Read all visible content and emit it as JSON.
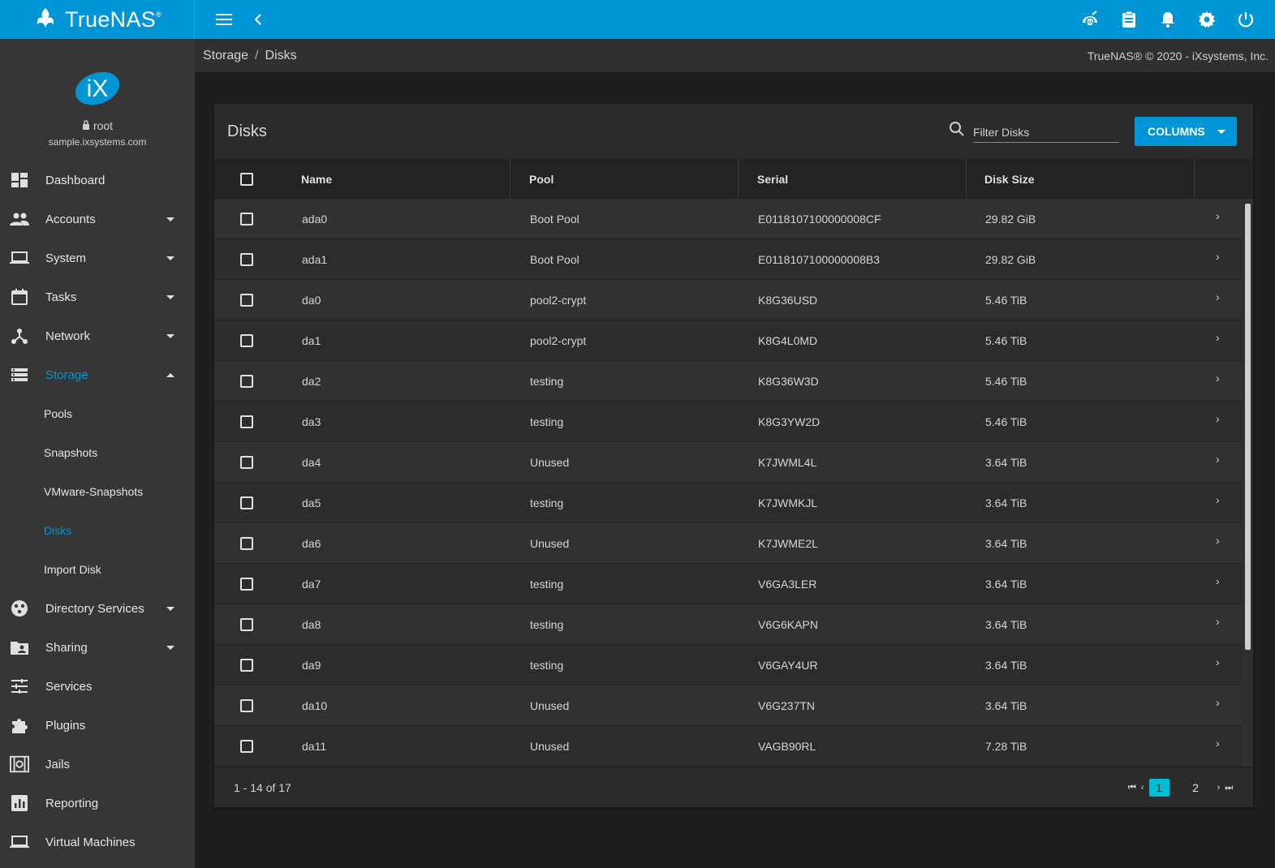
{
  "app": {
    "brand": "TrueNAS",
    "brand_reg": "®"
  },
  "colors": {
    "primary": "#0095d5",
    "accent": "#00bcd4",
    "sidebar_bg": "#363636",
    "content_bg": "#1e1e1e"
  },
  "topbar": {
    "icons": [
      "menu-icon",
      "back-icon",
      "ha-icon",
      "clipboard-icon",
      "bell-icon",
      "gear-icon",
      "power-icon"
    ]
  },
  "profile": {
    "logo_text": "iX",
    "user": "root",
    "host": "sample.ixsystems.com"
  },
  "sidebar": {
    "items": [
      {
        "label": "Dashboard",
        "icon": "dashboard-icon"
      },
      {
        "label": "Accounts",
        "icon": "accounts-icon"
      },
      {
        "label": "System",
        "icon": "laptop-icon"
      },
      {
        "label": "Tasks",
        "icon": "calendar-icon"
      },
      {
        "label": "Network",
        "icon": "network-icon"
      },
      {
        "label": "Storage",
        "icon": "storage-icon"
      },
      {
        "label": "Directory Services",
        "icon": "directory-icon"
      },
      {
        "label": "Sharing",
        "icon": "folder-shared-icon"
      },
      {
        "label": "Services",
        "icon": "tune-icon"
      },
      {
        "label": "Plugins",
        "icon": "puzzle-icon"
      },
      {
        "label": "Jails",
        "icon": "jail-icon"
      },
      {
        "label": "Reporting",
        "icon": "chart-icon"
      },
      {
        "label": "Virtual Machines",
        "icon": "computer-icon"
      }
    ],
    "storage_sub": [
      "Pools",
      "Snapshots",
      "VMware-Snapshots",
      "Disks",
      "Import Disk"
    ]
  },
  "breadcrumb": {
    "parent": "Storage",
    "sep": "/",
    "current": "Disks"
  },
  "copyright": "TrueNAS® © 2020 - iXsystems, Inc.",
  "card": {
    "title": "Disks",
    "filter_placeholder": "Filter Disks",
    "columns_button": "COLUMNS"
  },
  "table": {
    "headers": {
      "name": "Name",
      "pool": "Pool",
      "serial": "Serial",
      "size": "Disk Size"
    },
    "rows": [
      {
        "name": "ada0",
        "pool": "Boot Pool",
        "serial": "E0118107100000008CF",
        "size": "29.82 GiB"
      },
      {
        "name": "ada1",
        "pool": "Boot Pool",
        "serial": "E0118107100000008B3",
        "size": "29.82 GiB"
      },
      {
        "name": "da0",
        "pool": "pool2-crypt",
        "serial": "K8G36USD",
        "size": "5.46 TiB"
      },
      {
        "name": "da1",
        "pool": "pool2-crypt",
        "serial": "K8G4L0MD",
        "size": "5.46 TiB"
      },
      {
        "name": "da2",
        "pool": "testing",
        "serial": "K8G36W3D",
        "size": "5.46 TiB"
      },
      {
        "name": "da3",
        "pool": "testing",
        "serial": "K8G3YW2D",
        "size": "5.46 TiB"
      },
      {
        "name": "da4",
        "pool": "Unused",
        "serial": "K7JWML4L",
        "size": "3.64 TiB"
      },
      {
        "name": "da5",
        "pool": "testing",
        "serial": "K7JWMKJL",
        "size": "3.64 TiB"
      },
      {
        "name": "da6",
        "pool": "Unused",
        "serial": "K7JWME2L",
        "size": "3.64 TiB"
      },
      {
        "name": "da7",
        "pool": "testing",
        "serial": "V6GA3LER",
        "size": "3.64 TiB"
      },
      {
        "name": "da8",
        "pool": "testing",
        "serial": "V6G6KAPN",
        "size": "3.64 TiB"
      },
      {
        "name": "da9",
        "pool": "testing",
        "serial": "V6GAY4UR",
        "size": "3.64 TiB"
      },
      {
        "name": "da10",
        "pool": "Unused",
        "serial": "V6G237TN",
        "size": "3.64 TiB"
      },
      {
        "name": "da11",
        "pool": "Unused",
        "serial": "VAGB90RL",
        "size": "7.28 TiB"
      }
    ]
  },
  "pagination": {
    "range": "1 - 14 of 17",
    "pages": [
      "1",
      "2"
    ],
    "current": "1"
  }
}
